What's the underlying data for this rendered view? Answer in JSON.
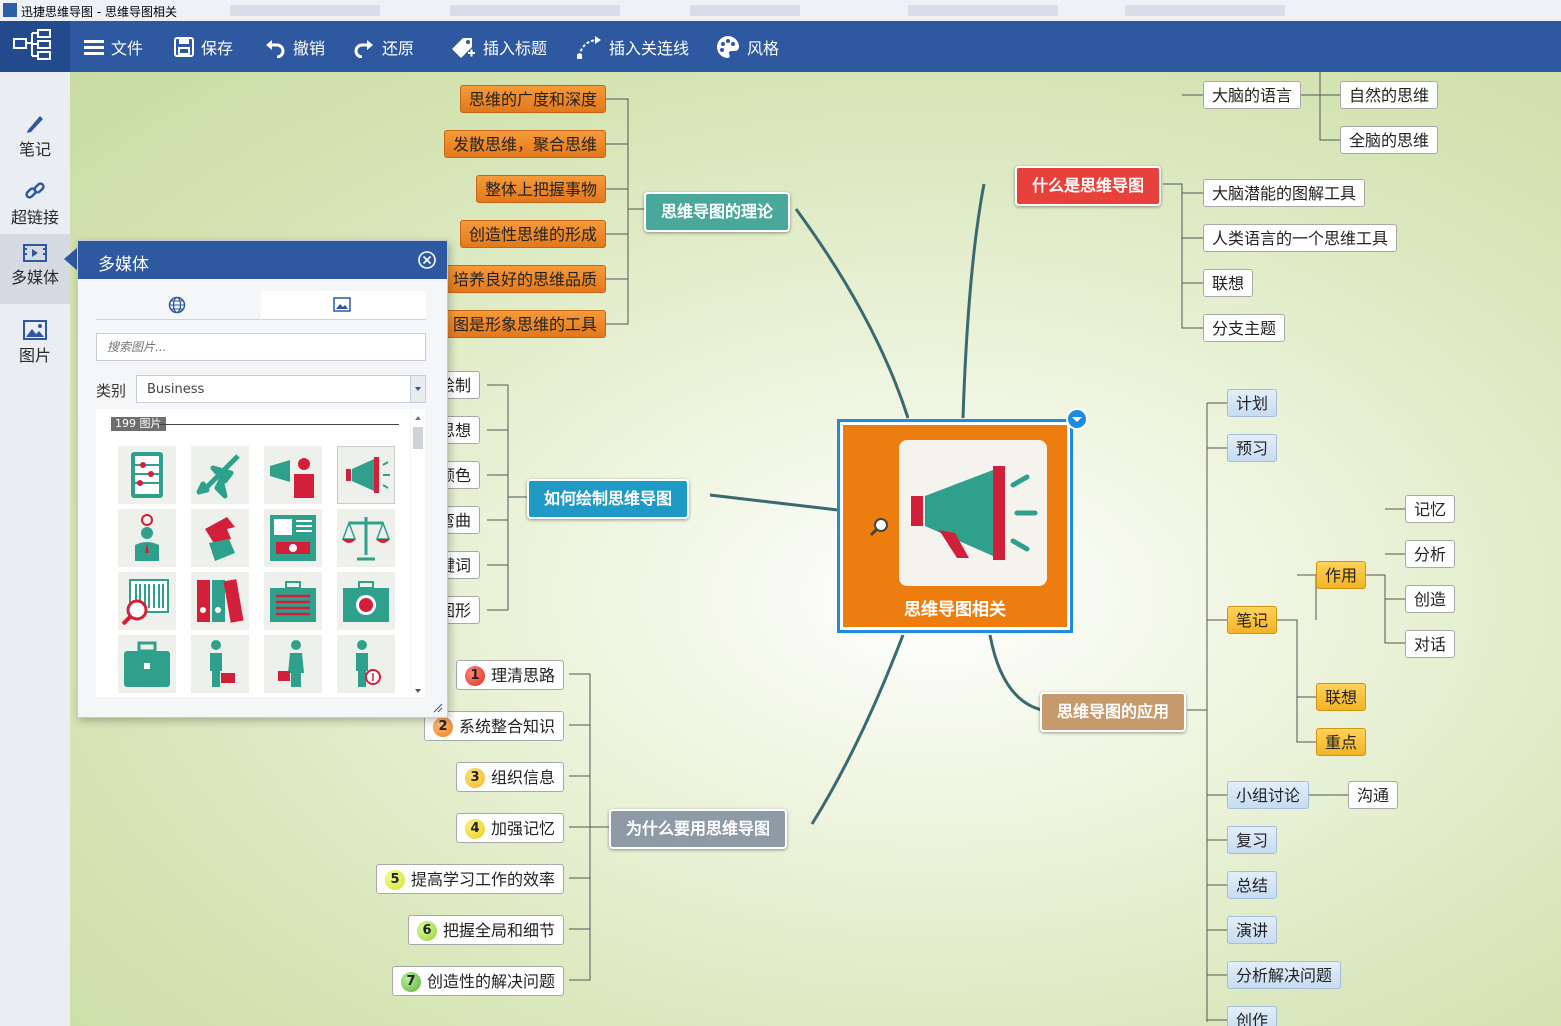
{
  "window": {
    "title": "迅捷思维导图 - 思维导图相关"
  },
  "toolbar": {
    "file": "文件",
    "save": "保存",
    "undo": "撤销",
    "redo": "还原",
    "insert_label": "插入标题",
    "insert_connector": "插入关连线",
    "style": "风格"
  },
  "sidebar": {
    "items": [
      {
        "label": "笔记",
        "icon": "pencil-icon"
      },
      {
        "label": "超链接",
        "icon": "link-icon"
      },
      {
        "label": "多媒体",
        "icon": "film-icon",
        "active": true
      },
      {
        "label": "图片",
        "icon": "picture-icon"
      }
    ]
  },
  "media_panel": {
    "title": "多媒体",
    "tabs": [
      {
        "icon": "globe-icon"
      },
      {
        "icon": "image-icon",
        "active": true
      }
    ],
    "search_placeholder": "搜索图片...",
    "category_label": "类别",
    "category_value": "Business",
    "count_label": "199 图片",
    "thumbnails": [
      "abacus-icon",
      "airplane-icon",
      "megaphone-person-icon",
      "megaphone-icon",
      "idea-person-icon",
      "arrows-icon",
      "atm-icon",
      "scales-icon",
      "barcode-search-icon",
      "binders-icon",
      "briefcase-lines-icon",
      "money-case-icon",
      "briefcase-icon",
      "person-bag-icon",
      "woman-bag-icon",
      "person-money-icon"
    ]
  },
  "mindmap": {
    "central": {
      "label": "思维导图相关"
    },
    "theory": {
      "label": "思维导图的理论",
      "children": [
        "思维的广度和深度",
        "发散思维，聚合思维",
        "整体上把握事物",
        "创造性思维的形成",
        "培养良好的思维品质",
        "图是形象思维的工具"
      ]
    },
    "what_is": {
      "label": "什么是思维导图",
      "children": [
        "大脑的语言",
        "大脑潜能的图解工具",
        "人类语言的一个思维工具",
        "联想",
        "分支主题"
      ],
      "sub_children": [
        "自然的思维",
        "全脑的思维"
      ]
    },
    "how_to": {
      "label": "如何绘制思维导图",
      "children": [
        "绘制",
        "思想",
        "颜色",
        "弯曲",
        "键词",
        "图形"
      ]
    },
    "why": {
      "label": "为什么要用思维导图",
      "children": [
        {
          "num": "1",
          "label": "理清思路"
        },
        {
          "num": "2",
          "label": "系统整合知识"
        },
        {
          "num": "3",
          "label": "组织信息"
        },
        {
          "num": "4",
          "label": "加强记忆"
        },
        {
          "num": "5",
          "label": "提高学习工作的效率"
        },
        {
          "num": "6",
          "label": "把握全局和细节"
        },
        {
          "num": "7",
          "label": "创造性的解决问题"
        }
      ]
    },
    "application": {
      "label": "思维导图的应用",
      "children": [
        "计划",
        "预习",
        "笔记",
        "小组讨论",
        "复习",
        "总结",
        "演讲",
        "分析解决问题",
        "创作"
      ],
      "notes_children": [
        "作用",
        "联想",
        "重点"
      ],
      "effect_children": [
        "记忆",
        "分析",
        "创造",
        "对话"
      ],
      "group_child": "沟通"
    }
  },
  "colors": {
    "toolbar": "#2e58a0",
    "theory": "#4aa89a",
    "what_is": "#e8403a",
    "how_to": "#1f9ac4",
    "why": "#8f9aa7",
    "application": "#c79a6e",
    "central": "#ee7d10"
  }
}
